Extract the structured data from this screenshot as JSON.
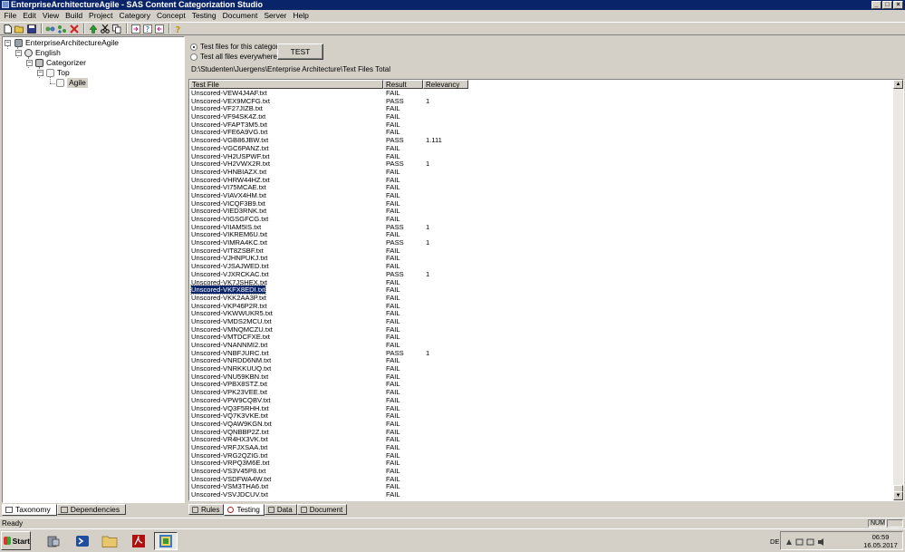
{
  "window": {
    "title": "EnterpriseArchitectureAgile - SAS Content Categorization Studio",
    "controls": [
      "minimize",
      "maximize",
      "close"
    ]
  },
  "menubar": [
    "File",
    "Edit",
    "View",
    "Build",
    "Project",
    "Category",
    "Concept",
    "Testing",
    "Document",
    "Server",
    "Help"
  ],
  "toolbar": {
    "icons": [
      "new-icon",
      "open-icon",
      "save-icon",
      "build-icon",
      "compile-icon",
      "delete-icon",
      "up-icon",
      "cut-icon",
      "copy-icon",
      "forward-icon",
      "back-icon",
      "help-icon",
      "undo-icon",
      "help-pointer-icon"
    ]
  },
  "tree": {
    "root": "EnterpriseArchitectureAgile",
    "language": "English",
    "categorizer": "Categorizer",
    "top": "Top",
    "selected": "Agile"
  },
  "left_tabs": [
    "Taxonomy",
    "Dependencies"
  ],
  "testing": {
    "option_category": "Test files for this category",
    "option_all": "Test all files everywhere",
    "test_button": "TEST",
    "path": "D:\\Studenten\\Juergens\\Enterprise Architecture\\Text Files Total"
  },
  "table": {
    "columns": [
      "Test File",
      "Result",
      "Relevancy"
    ],
    "selected_row": 24,
    "rows": [
      [
        "Unscored-VEW4J4AF.txt",
        "FAIL",
        ""
      ],
      [
        "Unscored-VEX9MCFG.txt",
        "PASS",
        "1"
      ],
      [
        "Unscored-VF27JIZB.txt",
        "FAIL",
        ""
      ],
      [
        "Unscored-VF94SK4Z.txt",
        "FAIL",
        ""
      ],
      [
        "Unscored-VFAPT3M5.txt",
        "FAIL",
        ""
      ],
      [
        "Unscored-VFE6A9VG.txt",
        "FAIL",
        ""
      ],
      [
        "Unscored-VGB86JBW.txt",
        "PASS",
        "1.111"
      ],
      [
        "Unscored-VGC6PANZ.txt",
        "FAIL",
        ""
      ],
      [
        "Unscored-VH2USPWF.txt",
        "FAIL",
        ""
      ],
      [
        "Unscored-VH2VWX2R.txt",
        "PASS",
        "1"
      ],
      [
        "Unscored-VHNBIAZX.txt",
        "FAIL",
        ""
      ],
      [
        "Unscored-VHRW44HZ.txt",
        "FAIL",
        ""
      ],
      [
        "Unscored-VI75MCAE.txt",
        "FAIL",
        ""
      ],
      [
        "Unscored-VIAVX4HM.txt",
        "FAIL",
        ""
      ],
      [
        "Unscored-VICQF3B9.txt",
        "FAIL",
        ""
      ],
      [
        "Unscored-VIED3RNK.txt",
        "FAIL",
        ""
      ],
      [
        "Unscored-VIGSGFCG.txt",
        "FAIL",
        ""
      ],
      [
        "Unscored-VIIAM5IS.txt",
        "PASS",
        "1"
      ],
      [
        "Unscored-VIKREM6U.txt",
        "FAIL",
        ""
      ],
      [
        "Unscored-VIMRA4KC.txt",
        "PASS",
        "1"
      ],
      [
        "Unscored-VIT8ZSBF.txt",
        "FAIL",
        ""
      ],
      [
        "Unscored-VJHNPUKJ.txt",
        "FAIL",
        ""
      ],
      [
        "Unscored-VJSAJWED.txt",
        "FAIL",
        ""
      ],
      [
        "Unscored-VJXRCKAC.txt",
        "PASS",
        "1"
      ],
      [
        "Unscored-VK7JSHEX.txt",
        "FAIL",
        ""
      ],
      [
        "Unscored-VKFX8EDI.txt",
        "FAIL",
        ""
      ],
      [
        "Unscored-VKK2AA3P.txt",
        "FAIL",
        ""
      ],
      [
        "Unscored-VKP46P2R.txt",
        "FAIL",
        ""
      ],
      [
        "Unscored-VKWWUKR5.txt",
        "FAIL",
        ""
      ],
      [
        "Unscored-VMDS2MCU.txt",
        "FAIL",
        ""
      ],
      [
        "Unscored-VMNQMCZU.txt",
        "FAIL",
        ""
      ],
      [
        "Unscored-VMTDCFXE.txt",
        "FAIL",
        ""
      ],
      [
        "Unscored-VNANNMI2.txt",
        "FAIL",
        ""
      ],
      [
        "Unscored-VNBFJURC.txt",
        "PASS",
        "1"
      ],
      [
        "Unscored-VNRDD6NM.txt",
        "FAIL",
        ""
      ],
      [
        "Unscored-VNRKKUUQ.txt",
        "FAIL",
        ""
      ],
      [
        "Unscored-VNU59KBN.txt",
        "FAIL",
        ""
      ],
      [
        "Unscored-VPBX8STZ.txt",
        "FAIL",
        ""
      ],
      [
        "Unscored-VPK23VEE.txt",
        "FAIL",
        ""
      ],
      [
        "Unscored-VPW9CQBV.txt",
        "FAIL",
        ""
      ],
      [
        "Unscored-VQ3F5RHH.txt",
        "FAIL",
        ""
      ],
      [
        "Unscored-VQ7K3VKE.txt",
        "FAIL",
        ""
      ],
      [
        "Unscored-VQAW9KGN.txt",
        "FAIL",
        ""
      ],
      [
        "Unscored-VQNBBP2Z.txt",
        "FAIL",
        ""
      ],
      [
        "Unscored-VR4HX3VK.txt",
        "FAIL",
        ""
      ],
      [
        "Unscored-VRFJXSAA.txt",
        "FAIL",
        ""
      ],
      [
        "Unscored-VRG2QZIG.txt",
        "FAIL",
        ""
      ],
      [
        "Unscored-VRPQ3M6E.txt",
        "FAIL",
        ""
      ],
      [
        "Unscored-VS3V45P8.txt",
        "FAIL",
        ""
      ],
      [
        "Unscored-VSDFWA4W.txt",
        "FAIL",
        ""
      ],
      [
        "Unscored-VSM3THA6.txt",
        "FAIL",
        ""
      ],
      [
        "Unscored-VSVJDCUV.txt",
        "FAIL",
        ""
      ]
    ]
  },
  "right_tabs": [
    "Rules",
    "Testing",
    "Data",
    "Document"
  ],
  "status": {
    "text": "Ready",
    "num": "NUM"
  },
  "taskbar": {
    "start": "Start",
    "apps": [
      "server-manager-icon",
      "powershell-icon",
      "explorer-icon",
      "pdf-reader-icon",
      "categorization-studio-icon"
    ],
    "lang": "DE",
    "time": "06:59",
    "date": "16.05.2017"
  },
  "colors": {
    "titlebar": "#0a246a",
    "selection": "#0a246a",
    "chrome": "#d4d0c8"
  }
}
